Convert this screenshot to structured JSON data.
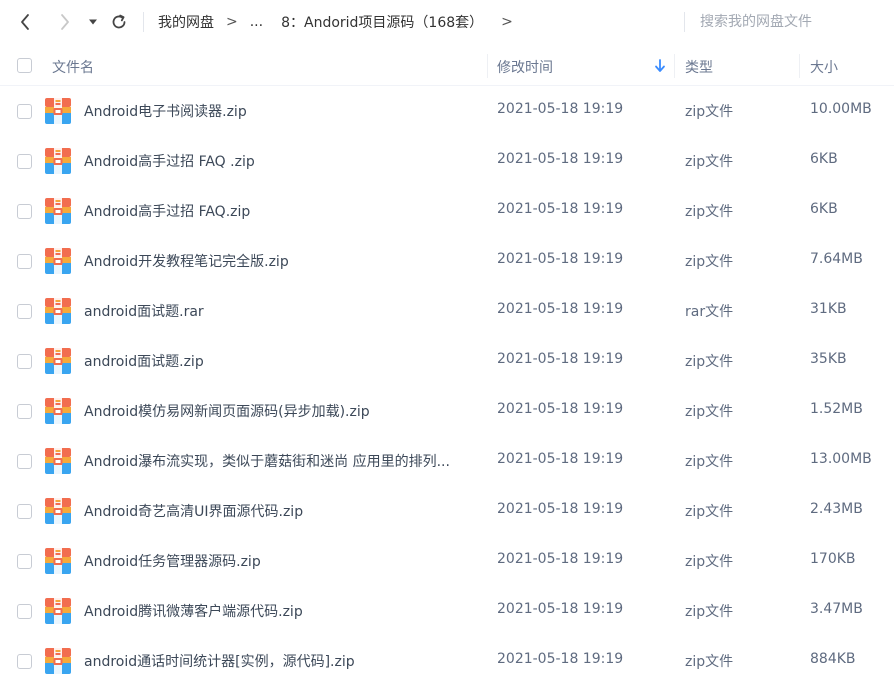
{
  "toolbar": {
    "breadcrumb": [
      "我的网盘",
      "...",
      "8：Andorid项目源码（168套）"
    ],
    "search_placeholder": "搜索我的网盘文件"
  },
  "header": {
    "name": "文件名",
    "modified": "修改时间",
    "type": "类型",
    "size": "大小"
  },
  "files": [
    {
      "name": "Android电子书阅读器.zip",
      "modified": "2021-05-18 19:19",
      "type": "zip文件",
      "size": "10.00MB"
    },
    {
      "name": "Android高手过招 FAQ .zip",
      "modified": "2021-05-18 19:19",
      "type": "zip文件",
      "size": "6KB"
    },
    {
      "name": "Android高手过招 FAQ.zip",
      "modified": "2021-05-18 19:19",
      "type": "zip文件",
      "size": "6KB"
    },
    {
      "name": "Android开发教程笔记完全版.zip",
      "modified": "2021-05-18 19:19",
      "type": "zip文件",
      "size": "7.64MB"
    },
    {
      "name": "android面试题.rar",
      "modified": "2021-05-18 19:19",
      "type": "rar文件",
      "size": "31KB"
    },
    {
      "name": "android面试题.zip",
      "modified": "2021-05-18 19:19",
      "type": "zip文件",
      "size": "35KB"
    },
    {
      "name": "Android模仿易网新闻页面源码(异步加载).zip",
      "modified": "2021-05-18 19:19",
      "type": "zip文件",
      "size": "1.52MB"
    },
    {
      "name": "Android瀑布流实现，类似于蘑菇街和迷尚 应用里的排列...",
      "modified": "2021-05-18 19:19",
      "type": "zip文件",
      "size": "13.00MB"
    },
    {
      "name": "Android奇艺高清UI界面源代码.zip",
      "modified": "2021-05-18 19:19",
      "type": "zip文件",
      "size": "2.43MB"
    },
    {
      "name": "Android任务管理器源码.zip",
      "modified": "2021-05-18 19:19",
      "type": "zip文件",
      "size": "170KB"
    },
    {
      "name": "Android腾讯微薄客户端源代码.zip",
      "modified": "2021-05-18 19:19",
      "type": "zip文件",
      "size": "3.47MB"
    },
    {
      "name": "android通话时间统计器[实例，源代码].zip",
      "modified": "2021-05-18 19:19",
      "type": "zip文件",
      "size": "884KB"
    }
  ],
  "icons": {
    "back": "chevron-left-icon",
    "forward": "chevron-right-icon",
    "history": "caret-down-icon",
    "refresh": "refresh-icon",
    "sort": "sort-arrow-down-icon",
    "file": "zip-archive-icon"
  },
  "colors": {
    "accent": "#3b8cff",
    "archive_icon_top": "#f26d4f",
    "archive_icon_mid": "#f6a93b",
    "archive_icon_bottom": "#3aa5f0"
  }
}
